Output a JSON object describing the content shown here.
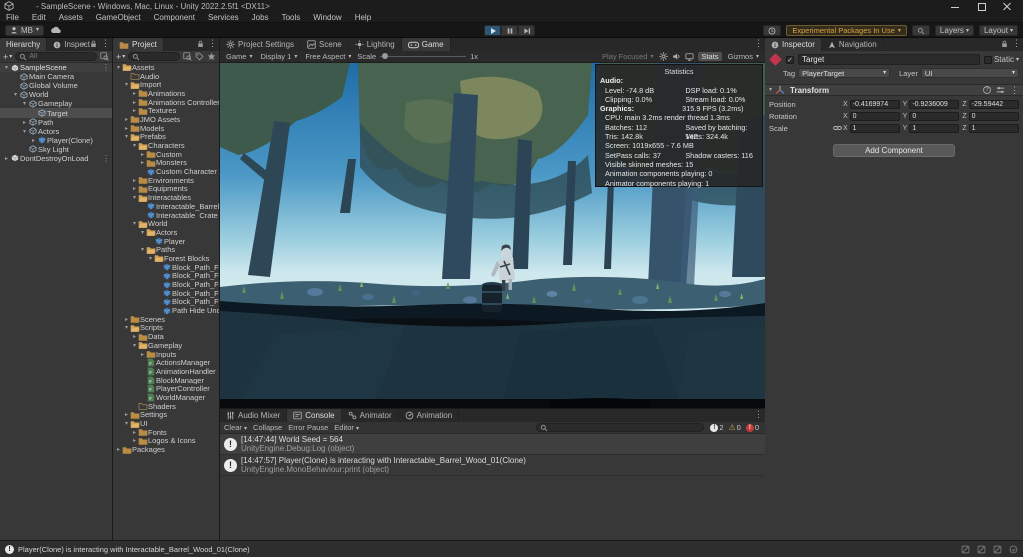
{
  "window": {
    "title": "- SampleScene - Windows, Mac, Linux - Unity 2022.2.5f1 <DX11>",
    "menus": [
      "File",
      "Edit",
      "Assets",
      "GameObject",
      "Component",
      "Services",
      "Jobs",
      "Tools",
      "Window",
      "Help"
    ]
  },
  "toolbar": {
    "account_label": "MB",
    "experimental_label": "Experimental Packages In Use",
    "layers_label": "Layers",
    "layout_label": "Layout"
  },
  "hierarchy": {
    "tab_label": "Hierarchy",
    "secondary_tab_label": "Inspect",
    "search_text": "All",
    "items": [
      {
        "label": "SampleScene",
        "depth": 0,
        "icon": "scene-icon",
        "arrow": "open",
        "scene_row": true,
        "kebab": true
      },
      {
        "label": "Main Camera",
        "depth": 1,
        "icon": "gameobject-icon"
      },
      {
        "label": "Global Volume",
        "depth": 1,
        "icon": "gameobject-icon"
      },
      {
        "label": "World",
        "depth": 1,
        "icon": "gameobject-icon",
        "arrow": "open"
      },
      {
        "label": "Gameplay",
        "depth": 2,
        "icon": "gameobject-icon",
        "arrow": "open"
      },
      {
        "label": "Target",
        "depth": 3,
        "icon": "gameobject-icon",
        "selected": true
      },
      {
        "label": "Path",
        "depth": 2,
        "icon": "gameobject-icon",
        "arrow": "closed"
      },
      {
        "label": "Actors",
        "depth": 2,
        "icon": "gameobject-icon",
        "arrow": "open"
      },
      {
        "label": "Player(Clone)",
        "depth": 3,
        "icon": "prefab-icon",
        "arrow": "closed"
      },
      {
        "label": "Sky Light",
        "depth": 2,
        "icon": "gameobject-icon"
      },
      {
        "label": "DontDestroyOnLoad",
        "depth": 0,
        "icon": "scene-icon",
        "arrow": "closed",
        "kebab": true
      }
    ]
  },
  "project": {
    "tab_label": "Project",
    "items": [
      {
        "label": "Assets",
        "depth": 0,
        "icon": "folder-open-icon",
        "arrow": "open"
      },
      {
        "label": "Audio",
        "depth": 1,
        "icon": "folder-empty-icon"
      },
      {
        "label": "Import",
        "depth": 1,
        "icon": "folder-open-icon",
        "arrow": "open"
      },
      {
        "label": "Animations",
        "depth": 2,
        "icon": "folder-icon",
        "arrow": "closed"
      },
      {
        "label": "Animations Controllers",
        "depth": 2,
        "icon": "folder-icon",
        "arrow": "closed"
      },
      {
        "label": "Textures",
        "depth": 2,
        "icon": "folder-icon",
        "arrow": "closed"
      },
      {
        "label": "JMO Assets",
        "depth": 1,
        "icon": "folder-icon",
        "arrow": "closed"
      },
      {
        "label": "Models",
        "depth": 1,
        "icon": "folder-icon",
        "arrow": "closed"
      },
      {
        "label": "Prefabs",
        "depth": 1,
        "icon": "folder-open-icon",
        "arrow": "open"
      },
      {
        "label": "Characters",
        "depth": 2,
        "icon": "folder-open-icon",
        "arrow": "open"
      },
      {
        "label": "Custom",
        "depth": 3,
        "icon": "folder-icon",
        "arrow": "closed"
      },
      {
        "label": "Monsters",
        "depth": 3,
        "icon": "folder-icon",
        "arrow": "closed"
      },
      {
        "label": "Custom Character",
        "depth": 3,
        "icon": "prefab-icon"
      },
      {
        "label": "Environments",
        "depth": 2,
        "icon": "folder-icon",
        "arrow": "closed"
      },
      {
        "label": "Equipments",
        "depth": 2,
        "icon": "folder-icon",
        "arrow": "closed"
      },
      {
        "label": "Interactables",
        "depth": 2,
        "icon": "folder-open-icon",
        "arrow": "open"
      },
      {
        "label": "Interactable_Barrel_W",
        "depth": 3,
        "icon": "prefab-icon"
      },
      {
        "label": "Interactable_Crate_W",
        "depth": 3,
        "icon": "prefab-icon"
      },
      {
        "label": "World",
        "depth": 2,
        "icon": "folder-open-icon",
        "arrow": "open"
      },
      {
        "label": "Actors",
        "depth": 3,
        "icon": "folder-open-icon",
        "arrow": "open"
      },
      {
        "label": "Player",
        "depth": 4,
        "icon": "prefab-icon"
      },
      {
        "label": "Paths",
        "depth": 3,
        "icon": "folder-open-icon",
        "arrow": "open"
      },
      {
        "label": "Forest Blocks",
        "depth": 4,
        "icon": "folder-open-icon",
        "arrow": "open"
      },
      {
        "label": "Block_Path_For",
        "depth": 5,
        "icon": "prefab-icon"
      },
      {
        "label": "Block_Path_For",
        "depth": 5,
        "icon": "prefab-icon"
      },
      {
        "label": "Block_Path_For",
        "depth": 5,
        "icon": "prefab-icon"
      },
      {
        "label": "Block_Path_For",
        "depth": 5,
        "icon": "prefab-icon"
      },
      {
        "label": "Block_Path_For",
        "depth": 5,
        "icon": "prefab-icon"
      },
      {
        "label": "Path Hide Under",
        "depth": 5,
        "icon": "prefab-icon"
      },
      {
        "label": "Scenes",
        "depth": 1,
        "icon": "folder-icon",
        "arrow": "closed"
      },
      {
        "label": "Scripts",
        "depth": 1,
        "icon": "folder-open-icon",
        "arrow": "open"
      },
      {
        "label": "Data",
        "depth": 2,
        "icon": "folder-icon",
        "arrow": "closed"
      },
      {
        "label": "Gameplay",
        "depth": 2,
        "icon": "folder-open-icon",
        "arrow": "open"
      },
      {
        "label": "Inputs",
        "depth": 3,
        "icon": "folder-icon",
        "arrow": "closed"
      },
      {
        "label": "ActionsManager",
        "depth": 3,
        "icon": "script-icon"
      },
      {
        "label": "AnimationHandler",
        "depth": 3,
        "icon": "script-icon"
      },
      {
        "label": "BlockManager",
        "depth": 3,
        "icon": "script-icon"
      },
      {
        "label": "PlayerController",
        "depth": 3,
        "icon": "script-icon"
      },
      {
        "label": "WorldManager",
        "depth": 3,
        "icon": "script-icon"
      },
      {
        "label": "Shaders",
        "depth": 2,
        "icon": "folder-empty-icon"
      },
      {
        "label": "Settings",
        "depth": 1,
        "icon": "folder-icon",
        "arrow": "closed"
      },
      {
        "label": "UI",
        "depth": 1,
        "icon": "folder-open-icon",
        "arrow": "open"
      },
      {
        "label": "Fonts",
        "depth": 2,
        "icon": "folder-icon",
        "arrow": "closed"
      },
      {
        "label": "Logos & Icons",
        "depth": 2,
        "icon": "folder-icon",
        "arrow": "closed"
      },
      {
        "label": "Packages",
        "depth": 0,
        "icon": "folder-icon",
        "arrow": "closed"
      }
    ]
  },
  "center": {
    "tabs": [
      {
        "label": "Project Settings",
        "icon": "settings-gear-icon",
        "active": false
      },
      {
        "label": "Scene",
        "icon": "scene-view-icon",
        "active": false
      },
      {
        "label": "Lighting",
        "icon": "lighting-icon",
        "active": false
      },
      {
        "label": "Game",
        "icon": "game-icon",
        "active": true
      }
    ],
    "game_toolbar": {
      "view_dropdown": "Game",
      "display_dropdown": "Display 1",
      "aspect_dropdown": "Free Aspect",
      "scale_label": "Scale",
      "scale_value": "1x",
      "play_focused_dropdown": "Play Focused",
      "stats_button": "Stats",
      "gizmos_dropdown": "Gizmos"
    }
  },
  "stats": {
    "title": "Statistics",
    "audio_label": "Audio:",
    "audio_rows": [
      {
        "l": "Level: -74.8 dB",
        "r": "DSP load: 0.1%"
      },
      {
        "l": "Clipping: 0.0%",
        "r": "Stream load: 0.0%"
      }
    ],
    "graphics_label": "Graphics:",
    "fps": "315.9 FPS (3.2ms)",
    "lines": [
      {
        "l": "CPU: main 3.2ms  render thread 1.3ms",
        "r": ""
      },
      {
        "l": "Batches: 112",
        "r": "Saved by batching: 142"
      },
      {
        "l": "Tris: 142.8k",
        "r": "Verts: 324.4k"
      },
      {
        "l": "Screen: 1019x655 - 7.6 MB",
        "r": ""
      },
      {
        "l": "SetPass calls: 37",
        "r": "Shadow casters: 116"
      },
      {
        "l": "Visible skinned meshes: 15",
        "r": ""
      },
      {
        "l": "Animation components playing: 0",
        "r": ""
      },
      {
        "l": "Animator components playing: 1",
        "r": ""
      }
    ]
  },
  "console": {
    "tabs": [
      {
        "label": "Audio Mixer",
        "icon": "audio-mixer-icon",
        "active": false
      },
      {
        "label": "Console",
        "icon": "console-icon",
        "active": true
      },
      {
        "label": "Animator",
        "icon": "animator-icon",
        "active": false
      },
      {
        "label": "Animation",
        "icon": "animation-icon",
        "active": false
      }
    ],
    "clear_button": "Clear",
    "collapse_button": "Collapse",
    "error_pause_button": "Error Pause",
    "editor_button": "Editor",
    "log_count": "2",
    "warning_count": "0",
    "error_count": "0",
    "entries": [
      {
        "message": "[14:47:44] World Seed = 564",
        "trace": "UnityEngine.Debug:Log (object)"
      },
      {
        "message": "[14:47:57] Player(Clone) is interacting with Interactable_Barrel_Wood_01(Clone)",
        "trace": "UnityEngine.MonoBehaviour:print (object)"
      }
    ]
  },
  "inspector": {
    "tabs": [
      {
        "label": "Inspector",
        "icon": "info-icon",
        "active": true
      },
      {
        "label": "Navigation",
        "icon": "navigation-icon",
        "active": false
      }
    ],
    "object_name": "Target",
    "static_label": "Static",
    "tag_label": "Tag",
    "tag_value": "PlayerTarget",
    "layer_label": "Layer",
    "layer_value": "UI",
    "transform": {
      "title": "Transform",
      "rows": [
        {
          "label": "Position",
          "x": "-0.4169974",
          "y": "-0.9236009",
          "z": "-29.59442",
          "linked": false
        },
        {
          "label": "Rotation",
          "x": "0",
          "y": "0",
          "z": "0",
          "linked": false
        },
        {
          "label": "Scale",
          "x": "1",
          "y": "1",
          "z": "1",
          "linked": true
        }
      ]
    },
    "add_component_button": "Add Component"
  },
  "statusbar": {
    "message": "Player(Clone) is interacting with Interactable_Barrel_Wood_01(Clone)"
  },
  "colors": {
    "accent_play": "#2e5571",
    "experimental_text": "#dca13e",
    "selection": "#4d4d4d",
    "folder": "#b98c45"
  }
}
